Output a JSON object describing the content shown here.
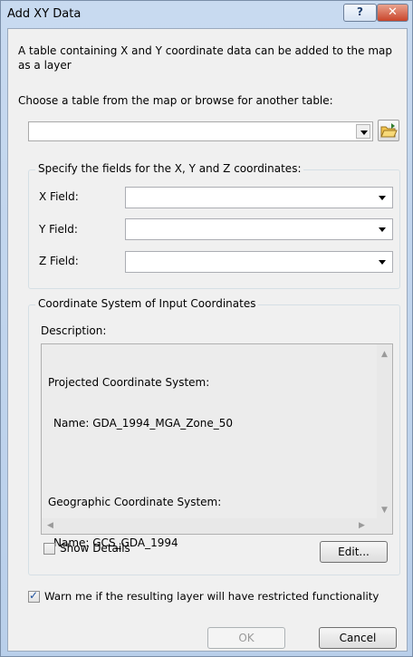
{
  "window": {
    "title": "Add XY Data",
    "help_label": "?",
    "close_label": "✕"
  },
  "intro": {
    "text": "A table containing X and Y coordinate data can be added to the map as a layer"
  },
  "table_chooser": {
    "label": "Choose a table from the map or browse for another table:",
    "value": ""
  },
  "fields_group": {
    "title": "Specify the fields for the X, Y and Z coordinates:",
    "x_label": "X Field:",
    "x_value": "",
    "y_label": "Y Field:",
    "y_value": "",
    "z_label": "Z Field:",
    "z_value": ""
  },
  "coord_group": {
    "title": "Coordinate System of Input Coordinates",
    "description_label": "Description:",
    "projected_heading": "Projected Coordinate System:",
    "projected_name": "Name: GDA_1994_MGA_Zone_50",
    "geographic_heading": "Geographic Coordinate System:",
    "geographic_name": "Name: GCS_GDA_1994",
    "show_details_label": "Show Details",
    "show_details_checked": false,
    "edit_label": "Edit..."
  },
  "warn": {
    "label": "Warn me if the resulting layer will have restricted functionality",
    "checked": true
  },
  "footer": {
    "ok_label": "OK",
    "ok_enabled": false,
    "cancel_label": "Cancel"
  }
}
